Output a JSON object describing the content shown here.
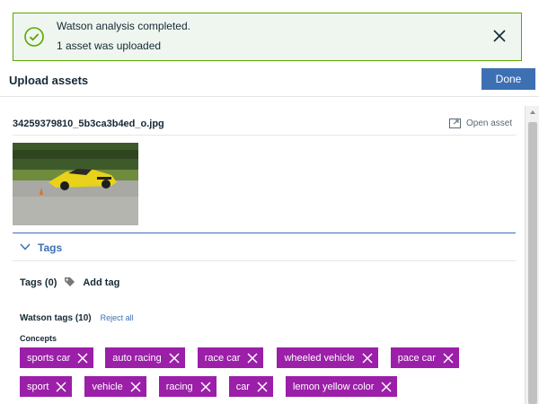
{
  "toast": {
    "title": "Watson analysis completed.",
    "subtitle": "1 asset was uploaded",
    "status_color": "#5aa700",
    "icon": "checkmark-circle-icon"
  },
  "header": {
    "title": "Upload assets",
    "done_label": "Done",
    "accent": "#3d70b2"
  },
  "asset": {
    "filename": "34259379810_5b3ca3b4ed_o.jpg",
    "open_label": "Open asset",
    "thumbnail": "yellow-sports-car-on-track"
  },
  "tags_section": {
    "label": "Tags",
    "user_tags_label": "Tags (0)",
    "add_tag_label": "Add tag",
    "watson_tags_label": "Watson tags (10)",
    "reject_all_label": "Reject all",
    "concepts_label": "Concepts",
    "chip_color": "#9b1fa8",
    "row1": [
      "sports car",
      "auto racing",
      "race car",
      "wheeled vehicle",
      "pace car"
    ],
    "row2": [
      "sport",
      "vehicle",
      "racing",
      "car",
      "lemon yellow color"
    ]
  }
}
